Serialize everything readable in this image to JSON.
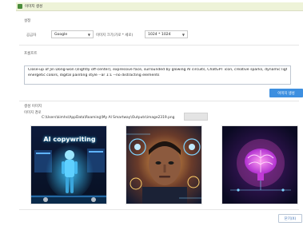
{
  "window": {
    "title": "이미지 생성"
  },
  "settings": {
    "section_label": "설정",
    "provider_label": "공급자",
    "provider_value": "Google",
    "size_label": "이미지 크기(가로 * 세로)",
    "size_value": "1024 * 1024"
  },
  "prompt": {
    "section_label": "프롬프트",
    "text_lines": [
      "Close-up of Jin Dong-won (slightly off-center), expressive face, surrounded by glowing AI circuits, ChatGPT icon, creative sparks, dynamic lighting,",
      "energetic colors, digital painting style --ar 1:1 --no distracting elements"
    ]
  },
  "generate_button": {
    "label": "이미지 생성"
  },
  "output": {
    "section_label": "생성 이미지",
    "save_label": "이미지 경로",
    "path": "C:\\Users\\kimhs\\AppData\\Roaming\\My AI Smartway\\Outputs\\image2319.png"
  },
  "images": [
    {
      "caption": "AI copywriting"
    },
    {
      "caption": ""
    },
    {
      "caption": ""
    }
  ],
  "close_button": {
    "label": "닫기(X)"
  }
}
